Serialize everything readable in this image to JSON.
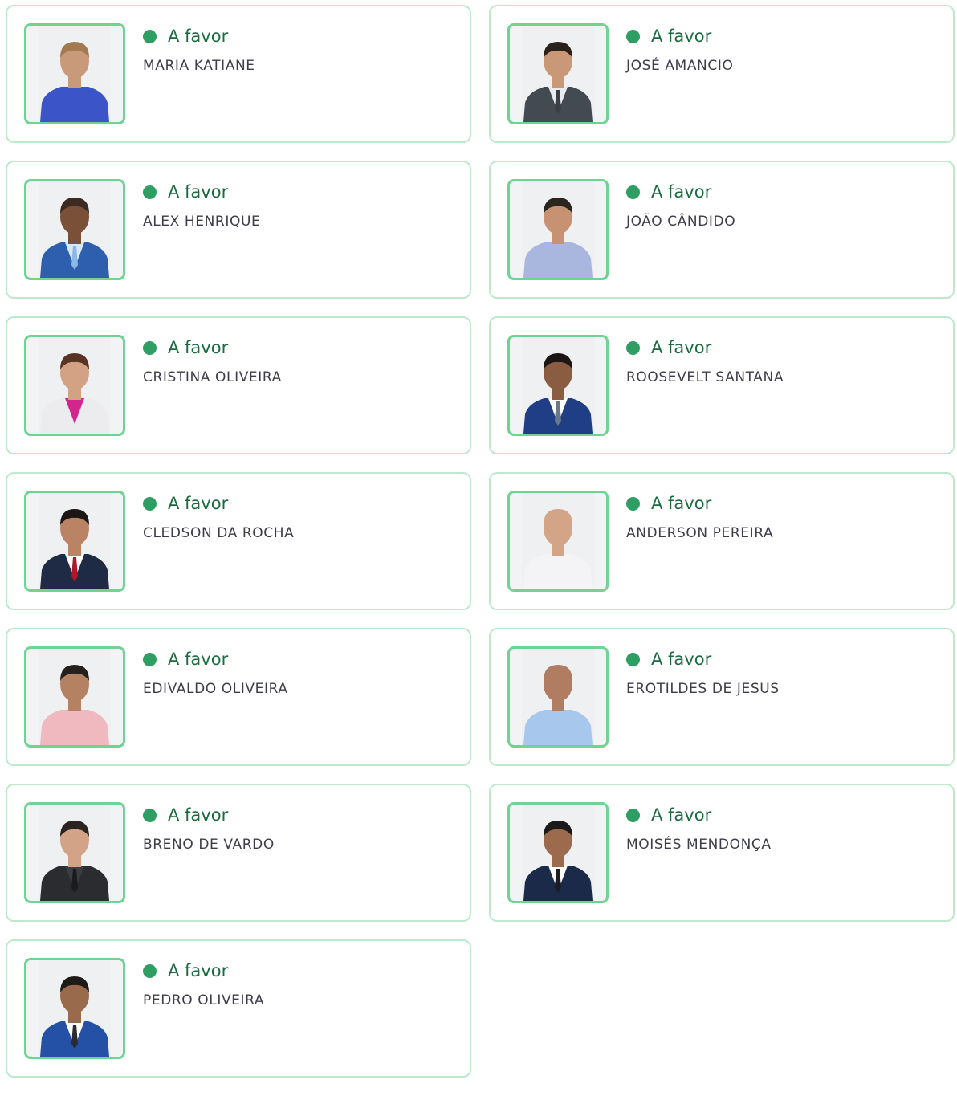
{
  "theme": {
    "card_border": "#bdeacb",
    "photo_border": "#6fd392",
    "vote_dot": "#2f9e62",
    "vote_text": "#1b6b41",
    "name_text": "#3d3d4a"
  },
  "votes": [
    {
      "name": "MARIA KATIANE",
      "vote": "A favor",
      "icon": "avatar-icon",
      "jacket": "#3b55c9",
      "shirt": "#3b55c9",
      "tie": "none",
      "skin": "#c99a7a",
      "hair": "#a37a4f"
    },
    {
      "name": "JOSÉ AMANCIO",
      "vote": "A favor",
      "icon": "avatar-icon",
      "jacket": "#444a52",
      "shirt": "#e9ecef",
      "tie": "#3a3f46",
      "skin": "#c99877",
      "hair": "#2a211b"
    },
    {
      "name": "ALEX HENRIQUE",
      "vote": "A favor",
      "icon": "avatar-icon",
      "jacket": "#2d5fae",
      "shirt": "#d9e7f7",
      "tie": "#8db8e6",
      "skin": "#7b5038",
      "hair": "#3b2a22"
    },
    {
      "name": "JOÃO CÂNDIDO",
      "vote": "A favor",
      "icon": "avatar-icon",
      "jacket": "#a9b6de",
      "shirt": "#a9b6de",
      "tie": "none",
      "skin": "#c79272",
      "hair": "#2b2520"
    },
    {
      "name": "CRISTINA OLIVEIRA",
      "vote": "A favor",
      "icon": "avatar-icon",
      "jacket": "#ecebed",
      "shirt": "#d2268d",
      "tie": "none",
      "skin": "#d3a184",
      "hair": "#5a3324"
    },
    {
      "name": "ROOSEVELT SANTANA",
      "vote": "A favor",
      "icon": "avatar-icon",
      "jacket": "#1f3e86",
      "shirt": "#ffffff",
      "tie": "#6b7785",
      "skin": "#8a5c42",
      "hair": "#1b1614"
    },
    {
      "name": "CLEDSON DA ROCHA",
      "vote": "A favor",
      "icon": "avatar-icon",
      "jacket": "#1f2b45",
      "shirt": "#ffffff",
      "tie": "#b0182a",
      "skin": "#b98364",
      "hair": "#1c1714"
    },
    {
      "name": "ANDERSON PEREIRA",
      "vote": "A favor",
      "icon": "avatar-icon",
      "jacket": "#f4f4f6",
      "shirt": "#f4f4f6",
      "tie": "none",
      "skin": "#d4a487",
      "hair": "#d4a487"
    },
    {
      "name": "EDIVALDO OLIVEIRA",
      "vote": "A favor",
      "icon": "avatar-icon",
      "jacket": "#f0b9c0",
      "shirt": "#f0b9c0",
      "tie": "none",
      "skin": "#b58163",
      "hair": "#26201c"
    },
    {
      "name": "EROTILDES DE JESUS",
      "vote": "A favor",
      "icon": "avatar-icon",
      "jacket": "#a7c7ec",
      "shirt": "#a7c7ec",
      "tie": "none",
      "skin": "#b07c62",
      "hair": "#b07c62"
    },
    {
      "name": "BRENO DE VARDO",
      "vote": "A favor",
      "icon": "avatar-icon",
      "jacket": "#2a2c30",
      "shirt": "#3a3d42",
      "tie": "#1a1b1d",
      "skin": "#d2a386",
      "hair": "#2a2320"
    },
    {
      "name": "MOISÉS MENDONÇA",
      "vote": "A favor",
      "icon": "avatar-icon",
      "jacket": "#1c2a4a",
      "shirt": "#ffffff",
      "tie": "#1b1d22",
      "skin": "#9c6a4c",
      "hair": "#1c1a19"
    },
    {
      "name": "PEDRO OLIVEIRA",
      "vote": "A favor",
      "icon": "avatar-icon",
      "jacket": "#2451a5",
      "shirt": "#ffffff",
      "tie": "#2a2b30",
      "skin": "#9a6a4d",
      "hair": "#1e1a18"
    }
  ]
}
